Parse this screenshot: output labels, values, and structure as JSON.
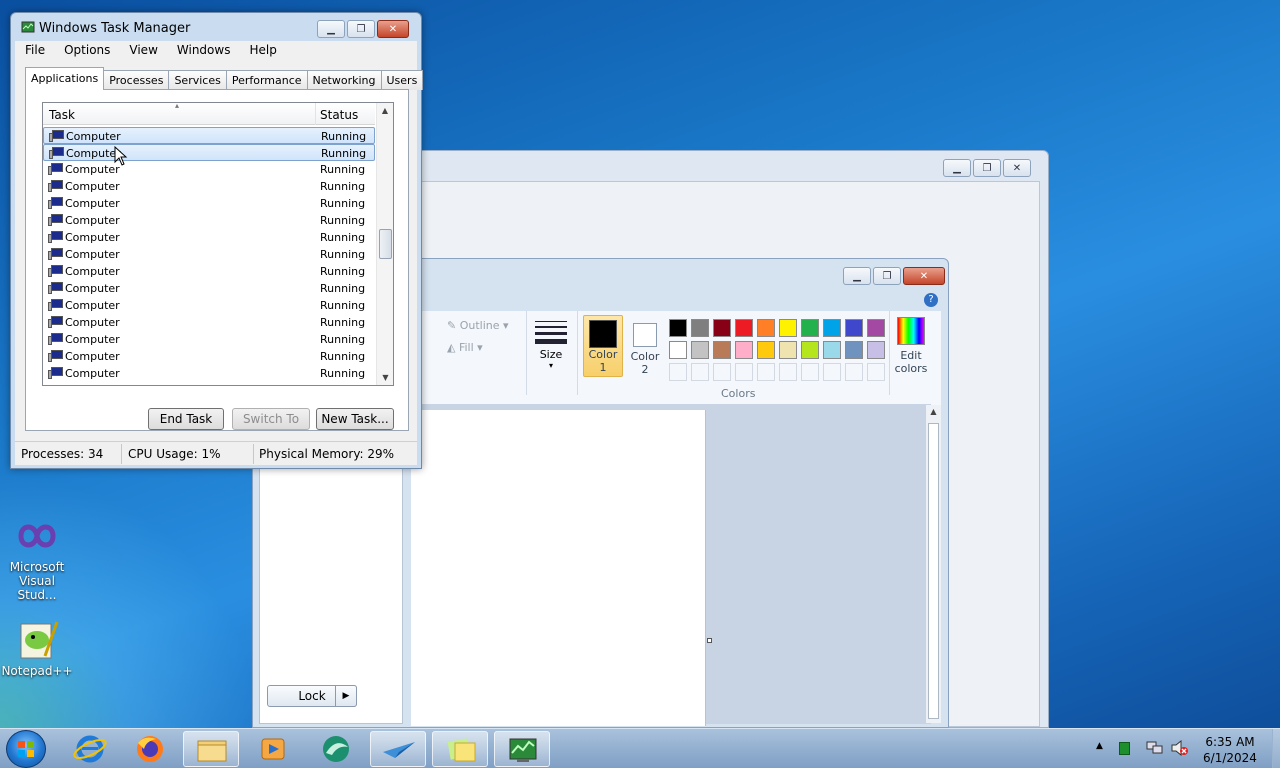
{
  "task_manager": {
    "title": "Windows Task Manager",
    "menus": [
      "File",
      "Options",
      "View",
      "Windows",
      "Help"
    ],
    "tabs": [
      "Applications",
      "Processes",
      "Services",
      "Performance",
      "Networking",
      "Users"
    ],
    "active_tab": "Applications",
    "columns": {
      "task": "Task",
      "status": "Status"
    },
    "rows": [
      {
        "task": "Computer",
        "status": "Running"
      },
      {
        "task": "Computer",
        "status": "Running"
      },
      {
        "task": "Computer",
        "status": "Running"
      },
      {
        "task": "Computer",
        "status": "Running"
      },
      {
        "task": "Computer",
        "status": "Running"
      },
      {
        "task": "Computer",
        "status": "Running"
      },
      {
        "task": "Computer",
        "status": "Running"
      },
      {
        "task": "Computer",
        "status": "Running"
      },
      {
        "task": "Computer",
        "status": "Running"
      },
      {
        "task": "Computer",
        "status": "Running"
      },
      {
        "task": "Computer",
        "status": "Running"
      },
      {
        "task": "Computer",
        "status": "Running"
      },
      {
        "task": "Computer",
        "status": "Running"
      },
      {
        "task": "Computer",
        "status": "Running"
      },
      {
        "task": "Computer",
        "status": "Running"
      }
    ],
    "selected_rows": [
      0,
      1
    ],
    "buttons": {
      "end_task": "End Task",
      "switch_to": "Switch To",
      "new_task": "New Task..."
    },
    "status_bar": {
      "processes": "Processes: 34",
      "cpu": "CPU Usage: 1%",
      "memory": "Physical Memory: 29%"
    }
  },
  "paint": {
    "outline": "Outline",
    "fill": "Fill",
    "size": "Size",
    "color1": [
      "Color",
      "1"
    ],
    "color2": [
      "Color",
      "2"
    ],
    "colors_group": "Colors",
    "edit_colors": [
      "Edit",
      "colors"
    ],
    "palette_row1": [
      "#000000",
      "#7f7f7f",
      "#880015",
      "#ed1c24",
      "#ff7f27",
      "#fff200",
      "#22b14c",
      "#00a2e8",
      "#3f48cc",
      "#a349a4"
    ],
    "palette_row2": [
      "#ffffff",
      "#c3c3c3",
      "#b97a57",
      "#ffaec9",
      "#ffc90e",
      "#efe4b0",
      "#b5e61d",
      "#99d9ea",
      "#7092be",
      "#c8bfe7"
    ],
    "lock_label": "Lock"
  },
  "desktop": {
    "icons": [
      {
        "label_line1": "Microsoft",
        "label_line2": "Visual Stud..."
      },
      {
        "label_line1": "Notepad++",
        "label_line2": ""
      }
    ]
  },
  "taskbar": {
    "time": "6:35 AM",
    "date": "6/1/2024"
  }
}
